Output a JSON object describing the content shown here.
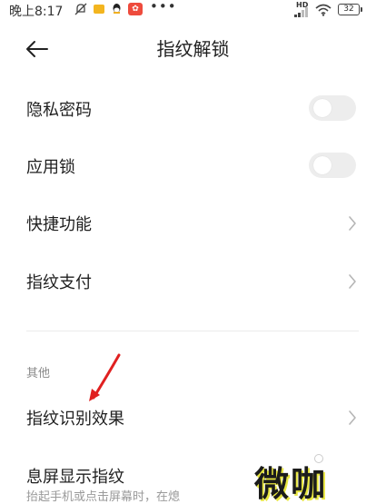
{
  "status_bar": {
    "time": "晚上8:17",
    "network": "HD",
    "battery": "32",
    "more": "•••"
  },
  "header": {
    "title": "指纹解锁"
  },
  "rows": [
    {
      "label": "隐私密码",
      "control": "toggle",
      "state": "off"
    },
    {
      "label": "应用锁",
      "control": "toggle",
      "state": "off"
    },
    {
      "label": "快捷功能",
      "control": "chevron"
    },
    {
      "label": "指纹支付",
      "control": "chevron"
    }
  ],
  "other_section": {
    "header": "其他",
    "items": [
      {
        "label": "指纹识别效果",
        "control": "chevron"
      },
      {
        "label": "息屏显示指纹",
        "subtext": "抬起手机或点击屏幕时，在熄"
      }
    ]
  },
  "watermark": {
    "text": "微咖"
  },
  "colors": {
    "accent_annotation": "#e02020",
    "toggle_off": "#ededed",
    "secondary_text": "#8a8a8a"
  }
}
